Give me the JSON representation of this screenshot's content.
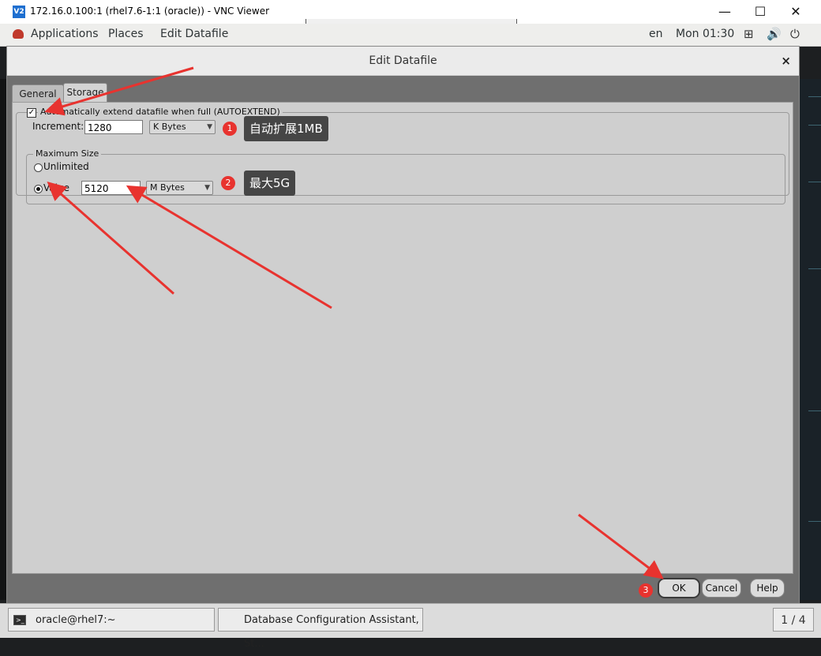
{
  "vnc": {
    "logo": "V2",
    "title": "172.16.0.100:1 (rhel7.6-1:1 (oracle)) - VNC Viewer",
    "min": "—",
    "max": "☐",
    "close": "✕"
  },
  "gnome": {
    "applications": "Applications",
    "places": "Places",
    "active_app": "Edit Datafile",
    "lang": "en",
    "clock": "Mon 01:30"
  },
  "dialog": {
    "title": "Edit Datafile",
    "close": "×",
    "tabs": [
      {
        "label": "General",
        "active": false
      },
      {
        "label": "Storage",
        "active": true
      }
    ],
    "autoextend": {
      "label": "Automatically extend datafile when full (AUTOEXTEND)",
      "checked": true,
      "increment_label": "Increment:",
      "increment_value": "1280",
      "increment_unit": "K Bytes"
    },
    "max_size": {
      "legend": "Maximum Size",
      "unlimited_label": "Unlimited",
      "value_label": "Value",
      "selected": "Value",
      "value": "5120",
      "unit": "M Bytes"
    },
    "buttons": {
      "ok": "OK",
      "cancel": "Cancel",
      "help": "Help"
    }
  },
  "annotations": [
    {
      "num": "1",
      "text": "自动扩展1MB"
    },
    {
      "num": "2",
      "text": "最大5G"
    },
    {
      "num": "3",
      "text": ""
    }
  ],
  "annotation_color": "#e8332f",
  "taskbar": {
    "items": [
      {
        "label": "oracle@rhel7:~"
      },
      {
        "label": "Database Configuration Assistant, St..."
      }
    ],
    "workspace": "1 / 4"
  }
}
